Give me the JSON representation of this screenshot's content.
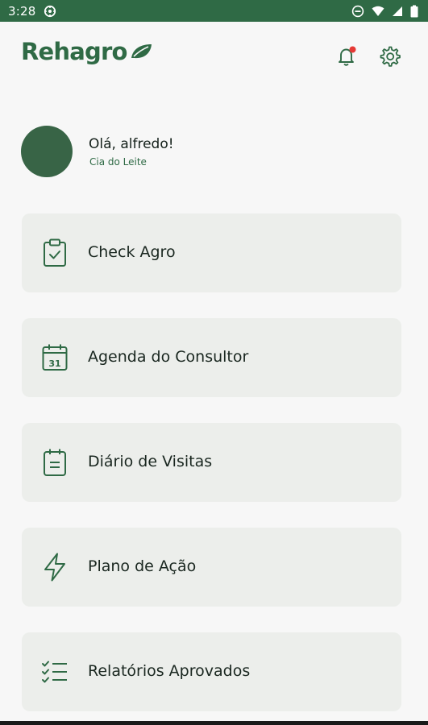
{
  "status_bar": {
    "time": "3:28",
    "icons": [
      "settings-gear-icon",
      "do-not-disturb-icon",
      "wifi-icon",
      "signal-icon",
      "battery-icon"
    ]
  },
  "header": {
    "logo_text": "Rehagro",
    "logo_icon": "leaf-icon",
    "notification_icon": "bell-icon",
    "notification_badge_color": "#e53935",
    "settings_icon": "gear-icon"
  },
  "profile": {
    "greeting": "Olá, alfredo!",
    "company": "Cia do Leite"
  },
  "menu": [
    {
      "label": "Check Agro",
      "icon": "clipboard-check-icon"
    },
    {
      "label": "Agenda do Consultor",
      "icon": "calendar-31-icon"
    },
    {
      "label": "Diário de Visitas",
      "icon": "notepad-icon"
    },
    {
      "label": "Plano de Ação",
      "icon": "lightning-icon"
    },
    {
      "label": "Relatórios Aprovados",
      "icon": "checklist-icon"
    }
  ],
  "colors": {
    "brand_green": "#2f6a45",
    "avatar_green": "#386446",
    "card_background": "#eceeeb",
    "page_background": "#f7f7f7"
  }
}
